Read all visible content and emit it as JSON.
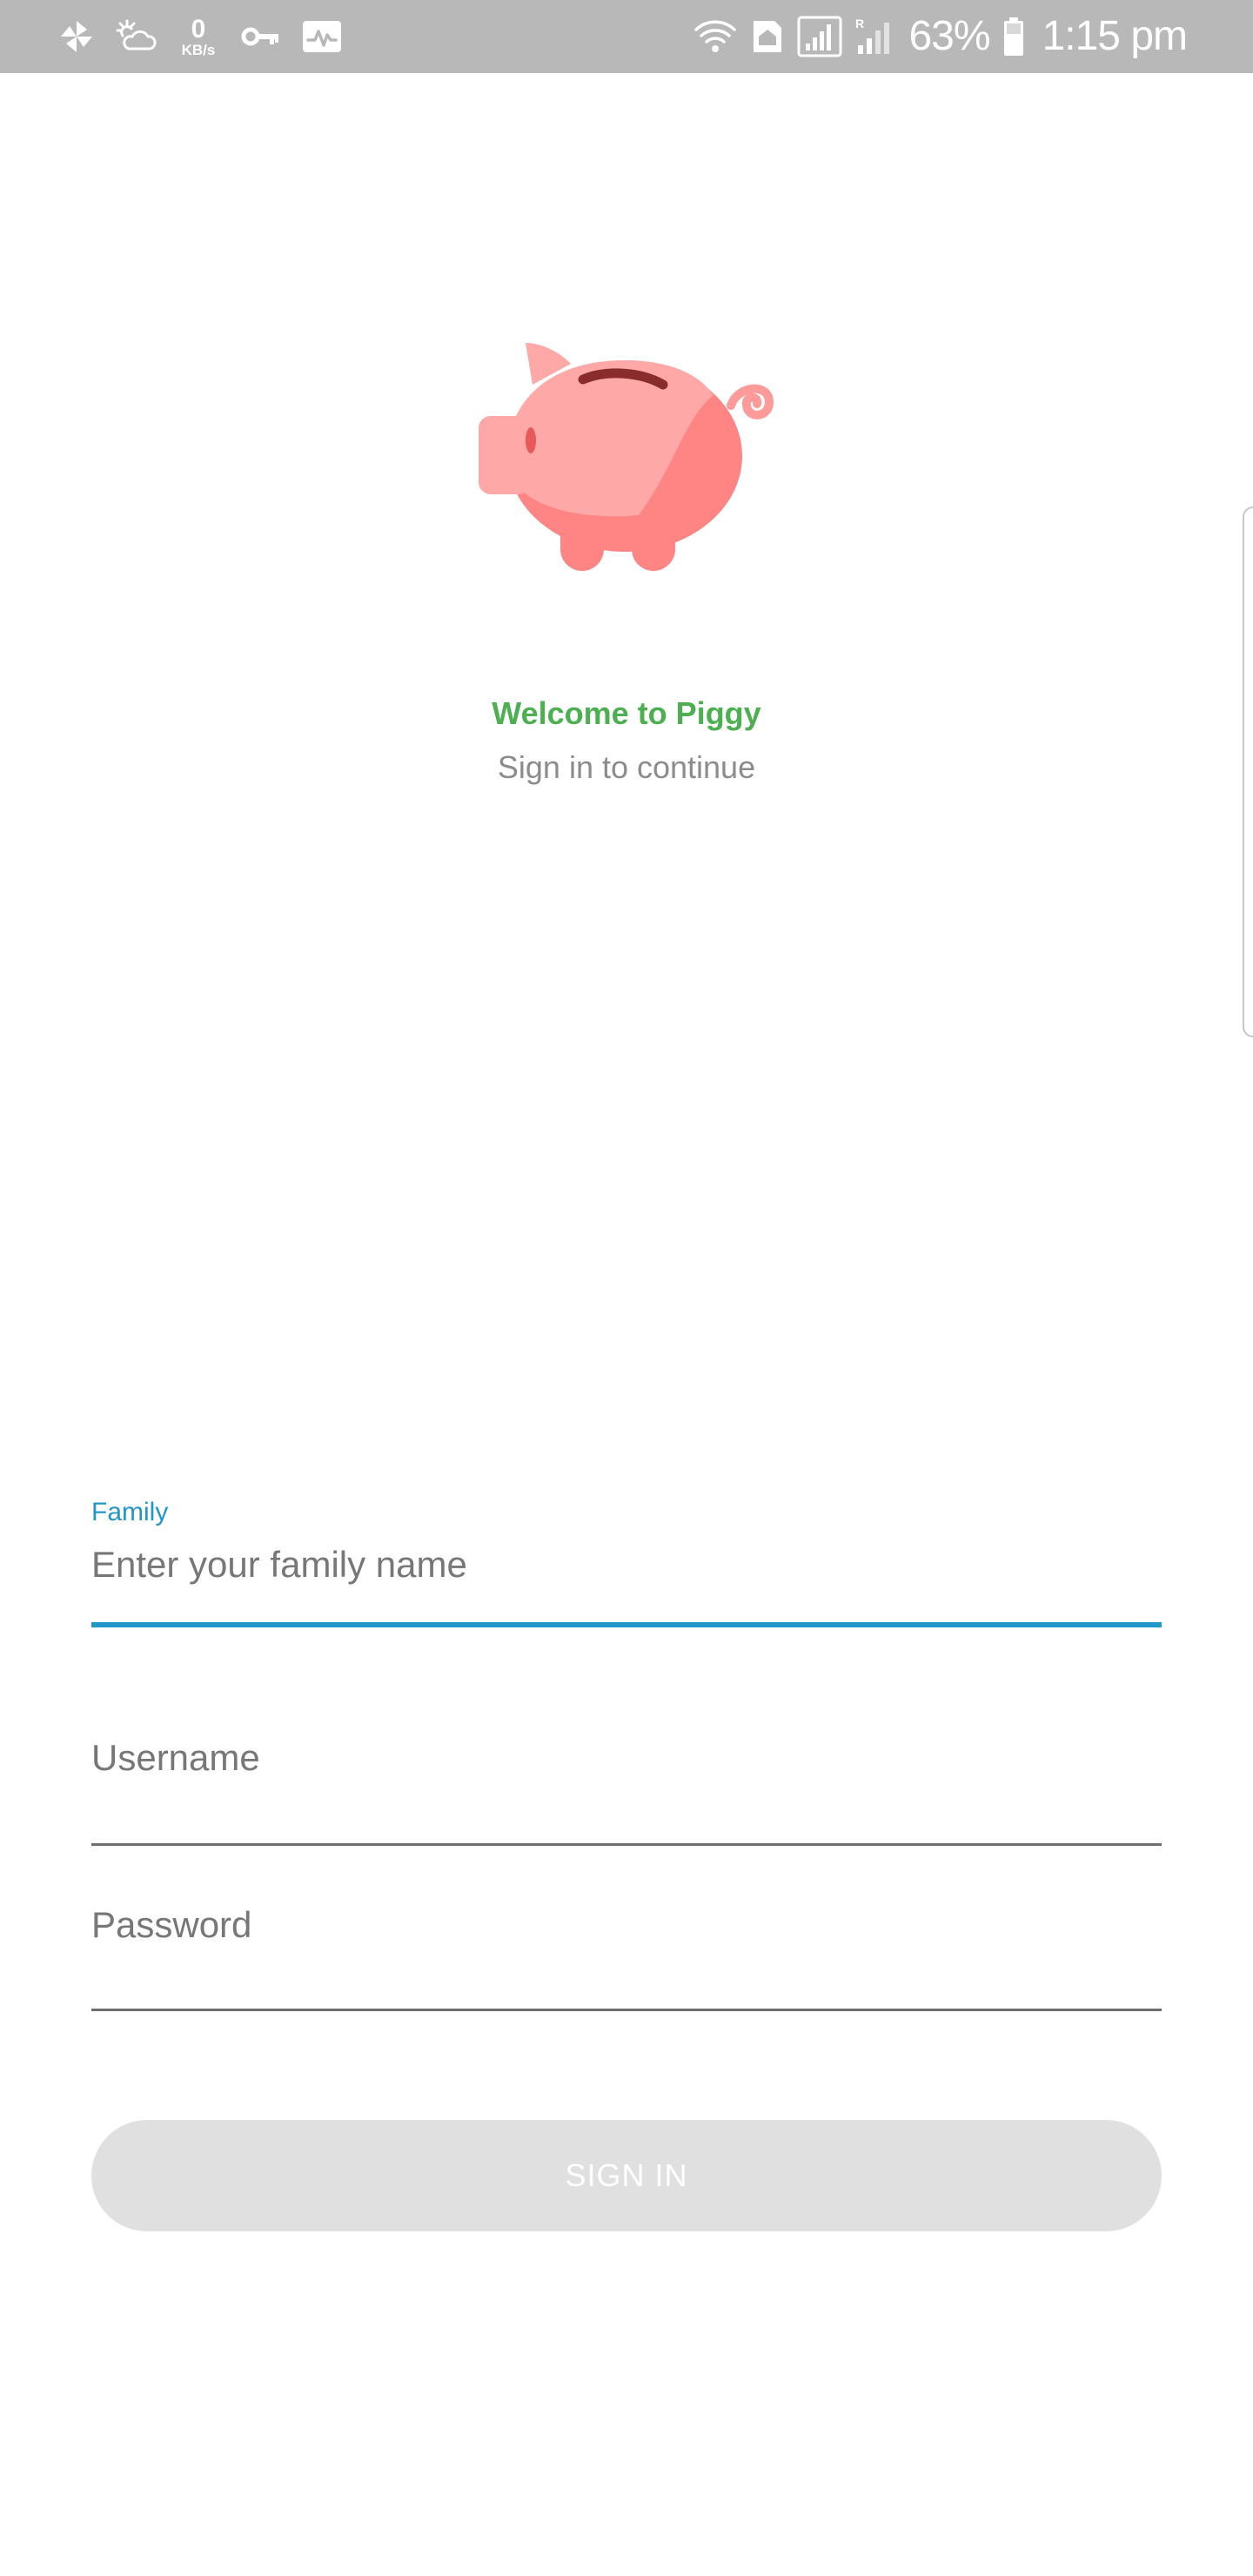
{
  "status_bar": {
    "net_speed_value": "0",
    "net_speed_unit": "KB/s",
    "battery_percent": "63%",
    "time": "1:15 pm",
    "icons": [
      "pinwheel-icon",
      "weather-icon",
      "network-speed-icon",
      "key-icon",
      "activity-icon",
      "wifi-icon",
      "home-sim-icon",
      "signal-icon",
      "roaming-signal-icon",
      "battery-icon"
    ]
  },
  "welcome": {
    "title": "Welcome to Piggy",
    "subtitle": "Sign in to continue"
  },
  "form": {
    "family": {
      "label": "Family",
      "value": "",
      "placeholder": "Enter your family name"
    },
    "username": {
      "value": "",
      "placeholder": "Username"
    },
    "password": {
      "value": "",
      "placeholder": "Password"
    },
    "sign_in_label": "SIGN IN"
  },
  "colors": {
    "status_bar": "#b8b8b8",
    "welcome_title": "#4caf50",
    "accent": "#2196c9",
    "subtitle": "#8c8c8c",
    "button_disabled": "#e0e0e0",
    "piggy_light": "#ffa8a8",
    "piggy_dark": "#ff8080"
  }
}
